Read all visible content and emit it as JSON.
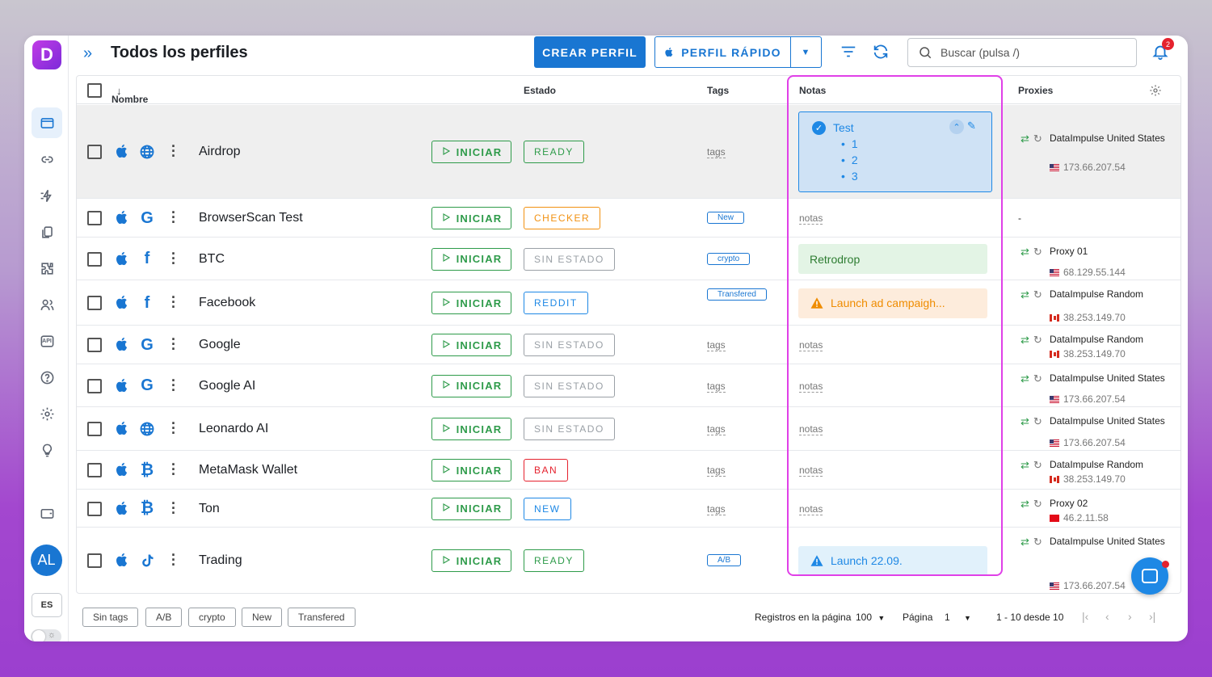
{
  "app": {
    "logo_letter": "D"
  },
  "sidebar": {
    "items": [
      {
        "name": "profiles-icon"
      },
      {
        "name": "link-icon"
      },
      {
        "name": "automation-icon"
      },
      {
        "name": "copy-icon"
      },
      {
        "name": "extensions-icon"
      },
      {
        "name": "users-icon"
      },
      {
        "name": "api-icon"
      },
      {
        "name": "help-icon"
      },
      {
        "name": "settings-icon"
      },
      {
        "name": "lightbulb-icon"
      },
      {
        "name": "wallet-icon"
      }
    ],
    "avatar": "AL",
    "language": "ES",
    "api_label": "API"
  },
  "header": {
    "title": "Todos los perfiles",
    "create_label": "CREAR PERFIL",
    "quick_label": "PERFIL RÁPIDO",
    "search_placeholder": "Buscar (pulsa /)",
    "notifications": "2"
  },
  "columns": {
    "name": "Nombre",
    "status": "Estado",
    "tags": "Tags",
    "notes": "Notas",
    "proxies": "Proxies"
  },
  "start_label": "INICIAR",
  "rows": [
    {
      "name": "Airdrop",
      "browser": "globe",
      "status": "READY",
      "status_color": "#2e9b4a",
      "tag": "tags",
      "tag_type": "link",
      "note_type": "list",
      "note_title": "Test",
      "note_items": [
        "1",
        "2",
        "3"
      ],
      "proxy": "DataImpulse United States",
      "ip": "173.66.207.54",
      "flag": "us"
    },
    {
      "name": "BrowserScan Test",
      "browser": "G",
      "status": "CHECKER",
      "status_color": "#f29111",
      "tag": "New",
      "tag_type": "chip",
      "note_type": "link",
      "note": "notas",
      "proxy_empty": "-"
    },
    {
      "name": "BTC",
      "browser": "f",
      "status": "SIN ESTADO",
      "status_color": "#9aa0a6",
      "tag": "crypto",
      "tag_type": "chip",
      "note_type": "box",
      "note": "Retrodrop",
      "note_bg": "#e3f4e5",
      "note_color": "#2e7d32",
      "proxy": "Proxy 01",
      "ip": "68.129.55.144",
      "flag": "us"
    },
    {
      "name": "Facebook",
      "browser": "f",
      "status": "REDDIT",
      "status_color": "#1e88e5",
      "tag": "Transfered",
      "tag_type": "chip",
      "note_type": "box",
      "note": "Launch ad campaigh...",
      "note_bg": "#fdecdc",
      "note_color": "#ef8c00",
      "note_icon": "warning",
      "proxy": "DataImpulse Random",
      "ip": "38.253.149.70",
      "flag": "ca"
    },
    {
      "name": "Google",
      "browser": "G",
      "status": "SIN ESTADO",
      "status_color": "#9aa0a6",
      "tag": "tags",
      "tag_type": "link",
      "note_type": "link",
      "note": "notas",
      "proxy": "DataImpulse Random",
      "ip": "38.253.149.70",
      "flag": "ca"
    },
    {
      "name": "Google AI",
      "browser": "G",
      "status": "SIN ESTADO",
      "status_color": "#9aa0a6",
      "tag": "tags",
      "tag_type": "link",
      "note_type": "link",
      "note": "notas",
      "proxy": "DataImpulse United States",
      "ip": "173.66.207.54",
      "flag": "us"
    },
    {
      "name": "Leonardo AI",
      "browser": "globe",
      "status": "SIN ESTADO",
      "status_color": "#9aa0a6",
      "tag": "tags",
      "tag_type": "link",
      "note_type": "link",
      "note": "notas",
      "proxy": "DataImpulse United States",
      "ip": "173.66.207.54",
      "flag": "us"
    },
    {
      "name": "MetaMask Wallet",
      "browser": "B",
      "status": "BAN",
      "status_color": "#e5222e",
      "tag": "tags",
      "tag_type": "link",
      "note_type": "link",
      "note": "notas",
      "proxy": "DataImpulse Random",
      "ip": "38.253.149.70",
      "flag": "ca"
    },
    {
      "name": "Ton",
      "browser": "B",
      "status": "NEW",
      "status_color": "#1e88e5",
      "tag": "tags",
      "tag_type": "link",
      "note_type": "link",
      "note": "notas",
      "proxy": "Proxy 02",
      "ip": "46.2.11.58",
      "flag": "tr"
    },
    {
      "name": "Trading",
      "browser": "tiktok",
      "status": "READY",
      "status_color": "#2e9b4a",
      "tag": "A/B",
      "tag_type": "chip",
      "note_type": "box",
      "note": "Launch 22.09.",
      "note_bg": "#e1f1fb",
      "note_color": "#1e88e5",
      "note_icon": "warning",
      "proxy": "DataImpulse United States",
      "ip": "173.66.207.54",
      "flag": "us"
    }
  ],
  "footer": {
    "tag_filters": [
      "Sin tags",
      "A/B",
      "crypto",
      "New",
      "Transfered"
    ],
    "per_page_label": "Registros en la página",
    "per_page_value": "100",
    "page_label": "Página",
    "page_value": "1",
    "range": "1 - 10 desde 10"
  }
}
